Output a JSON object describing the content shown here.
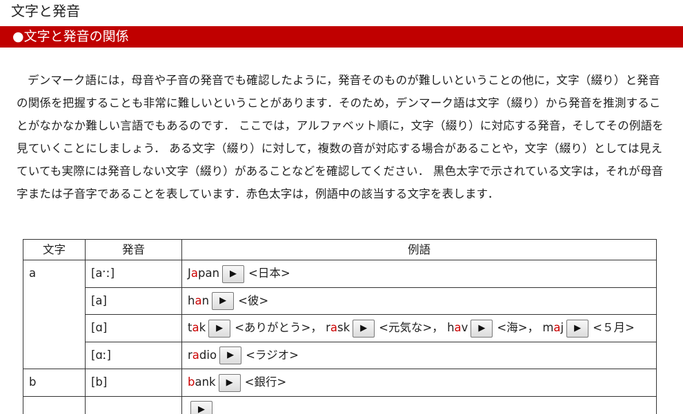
{
  "page_title": "文字と発音",
  "section_heading": "●文字と発音の関係",
  "intro": "デンマーク語には，母音や子音の発音でも確認したように，発音そのものが難しいということの他に，文字（綴り）と発音の関係を把握することも非常に難しいということがあります．そのため，デンマーク語は文字（綴り）から発音を推測することがなかなか難しい言語でもあるのです． ここでは，アルファベット順に，文字（綴り）に対応する発音，そしてその例語を見ていくことにしましょう． ある文字（綴り）に対して，複数の音が対応する場合があることや，文字（綴り）としては見えていても実際には発音しない文字（綴り）があることなどを確認してください． 黒色太字で示されている文字は，それが母音字または子音字であることを表しています．赤色太字は，例語中の該当する文字を表します．",
  "table": {
    "headers": {
      "letter": "文字",
      "pronunciation": "発音",
      "examples": "例語"
    },
    "play_symbol": "▶",
    "rows": {
      "a1": {
        "letter": "a",
        "pron": "[aˑː]",
        "ex": {
          "w1": {
            "pre": "J",
            "hl": "a",
            "post": "pan",
            "gloss": "<日本>"
          }
        }
      },
      "a2": {
        "pron": "[a]",
        "ex": {
          "w1": {
            "pre": "h",
            "hl": "a",
            "post": "n",
            "gloss": "<彼>"
          }
        }
      },
      "a3": {
        "pron": "[ɑ]",
        "ex": {
          "w1": {
            "pre": "t",
            "hl": "a",
            "post": "k",
            "gloss": "<ありがとう>，"
          },
          "w2": {
            "pre": "r",
            "hl": "a",
            "post": "sk",
            "gloss": "<元気な>，"
          },
          "w3": {
            "pre": "h",
            "hl": "a",
            "post": "v",
            "gloss": "<海>，"
          },
          "w4": {
            "pre": "m",
            "hl": "a",
            "post": "j",
            "gloss": "<５月>"
          }
        }
      },
      "a4": {
        "pron": "[ɑː]",
        "ex": {
          "w1": {
            "pre": "r",
            "hl": "a",
            "post": "dio",
            "gloss": "<ラジオ>"
          }
        }
      },
      "b1": {
        "letter": "b",
        "pron": "[b]",
        "ex": {
          "w1": {
            "pre": "",
            "hl": "b",
            "post": "ank",
            "gloss": "<銀行>"
          }
        }
      }
    }
  }
}
